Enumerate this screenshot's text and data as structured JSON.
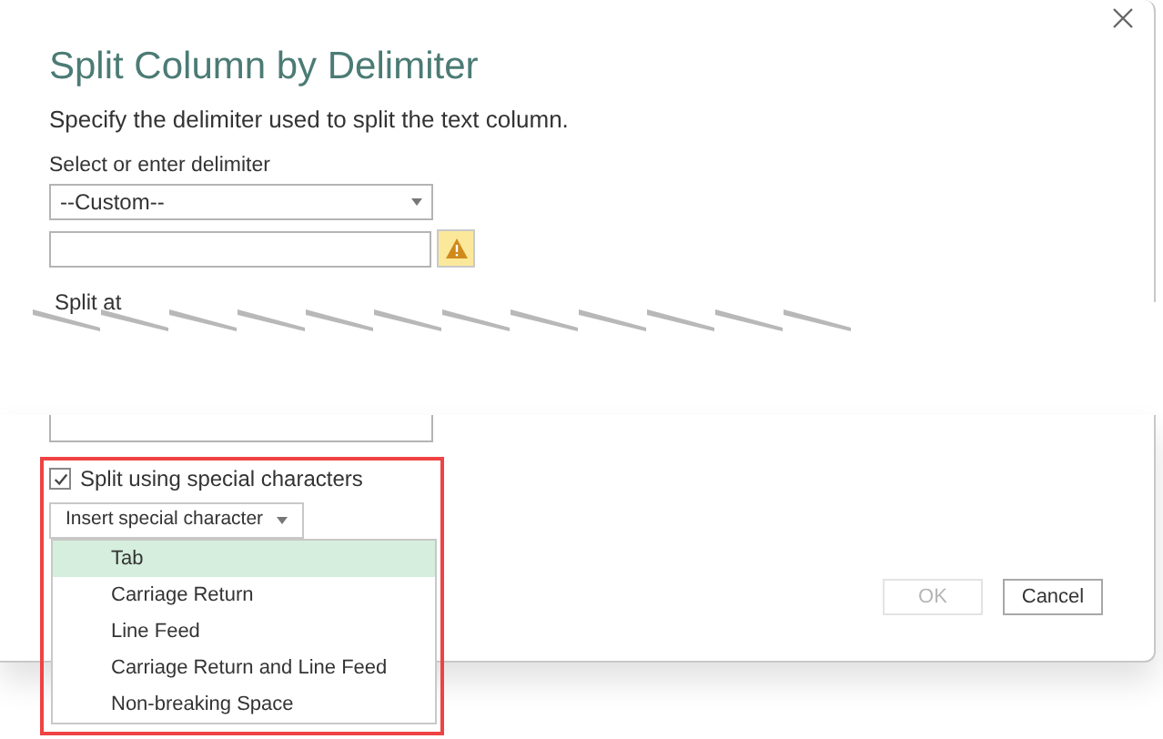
{
  "dialog": {
    "title": "Split Column by Delimiter",
    "description": "Specify the delimiter used to split the text column.",
    "delimiter": {
      "label": "Select or enter delimiter",
      "value": "--Custom--"
    },
    "custom_delimiter": {
      "warning": true
    },
    "split_at": {
      "label": "Split at"
    },
    "special_characters": {
      "label": "Split using special characters",
      "checked": true
    },
    "insert_button": "Insert special character",
    "menu": [
      {
        "label": "Tab",
        "selected": true
      },
      {
        "label": "Carriage Return",
        "selected": false
      },
      {
        "label": "Line Feed",
        "selected": false
      },
      {
        "label": "Carriage Return and Line Feed",
        "selected": false
      },
      {
        "label": "Non-breaking Space",
        "selected": false
      }
    ],
    "buttons": [
      {
        "label": "OK",
        "disabled": true
      },
      {
        "label": "Cancel",
        "disabled": false
      }
    ]
  }
}
